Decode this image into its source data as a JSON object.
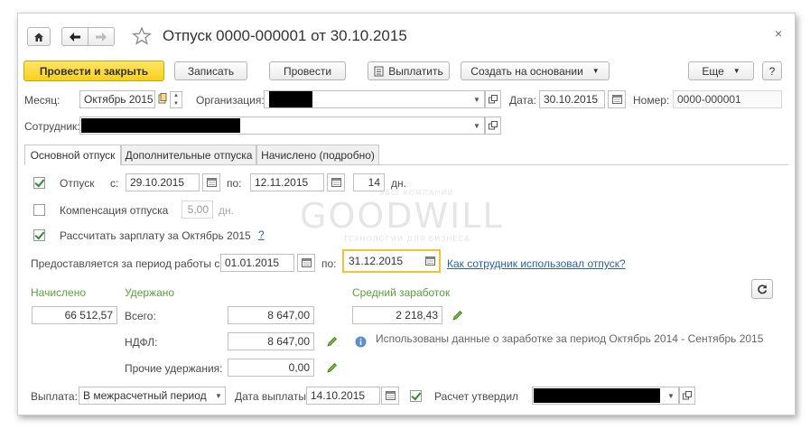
{
  "title": "Отпуск 0000-000001 от 30.10.2015",
  "toolbar": {
    "post_close": "Провести и закрыть",
    "save": "Записать",
    "post": "Провести",
    "pay": "Выплатить",
    "create_based": "Создать на основании",
    "more": "Еще",
    "help": "?"
  },
  "header": {
    "month_label": "Месяц:",
    "month_value": "Октябрь 2015",
    "org_label": "Организация:",
    "date_label": "Дата:",
    "date_value": "30.10.2015",
    "number_label": "Номер:",
    "number_value": "0000-000001",
    "employee_label": "Сотрудник:"
  },
  "tabs": [
    "Основной отпуск",
    "Дополнительные отпуска",
    "Начислено (подробно)"
  ],
  "main": {
    "vacation_label": "Отпуск",
    "from_label": "с:",
    "from_value": "29.10.2015",
    "to_label": "по:",
    "to_value": "12.11.2015",
    "days_value": "14",
    "days_unit": "дн.",
    "compensation_label": "Компенсация отпуска",
    "compensation_value": "5,00",
    "compensation_unit": "дн.",
    "calc_salary_label": "Рассчитать зарплату за Октябрь 2015",
    "calc_help": "?",
    "period_label": "Предоставляется за период работы с:",
    "period_from": "01.01.2015",
    "period_to_label": "по:",
    "period_to": "31.12.2015",
    "period_link": "Как сотрудник использовал отпуск?"
  },
  "accrued": {
    "accrued_header": "Начислено",
    "accrued_value": "66 512,57",
    "withheld_header": "Удержано",
    "total_label": "Всего:",
    "total_value": "8 647,00",
    "ndfl_label": "НДФЛ:",
    "ndfl_value": "8 647,00",
    "other_label": "Прочие удержания:",
    "other_value": "0,00",
    "avg_header": "Средний заработок",
    "avg_value": "2 218,43",
    "info_text": "Использованы данные о заработке за период Октябрь 2014 - Сентябрь 2015"
  },
  "footer": {
    "payout_label": "Выплата:",
    "payout_value": "В межрасчетный период",
    "payout_date_label": "Дата выплаты:",
    "payout_date_value": "14.10.2015",
    "approved_label": "Расчет утвердил"
  },
  "watermark": {
    "top": "ВАШ КОМПАНИИ",
    "main": "GOODWILL",
    "bottom": "ТЕХНОЛОГИИ ДЛЯ БИЗНЕСА"
  },
  "colors": {
    "primary_button": "#f7d11c",
    "green_label": "#5b9e38",
    "link": "#2a5fa8",
    "focus_border": "#f2c231"
  }
}
